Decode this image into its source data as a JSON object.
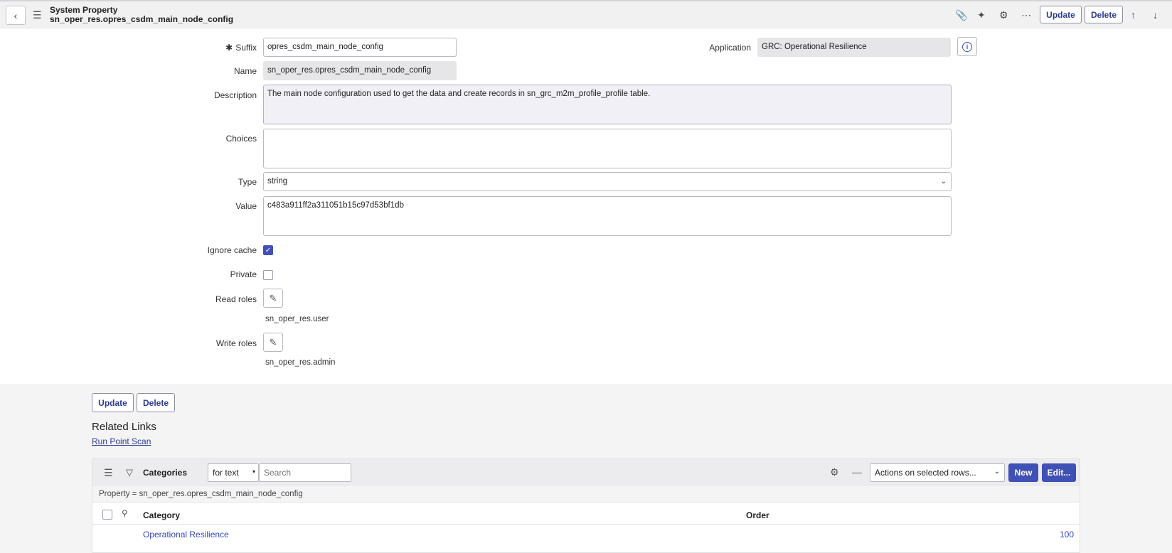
{
  "header": {
    "record_type": "System Property",
    "record_name": "sn_oper_res.opres_csdm_main_node_config",
    "update_label": "Update",
    "delete_label": "Delete"
  },
  "form": {
    "suffix": {
      "label": "Suffix",
      "value": "opres_csdm_main_node_config"
    },
    "name": {
      "label": "Name",
      "value": "sn_oper_res.opres_csdm_main_node_config"
    },
    "application": {
      "label": "Application",
      "value": "GRC: Operational Resilience"
    },
    "description": {
      "label": "Description",
      "value": "The main node configuration used to get the data and create records in sn_grc_m2m_profile_profile table."
    },
    "choices": {
      "label": "Choices",
      "value": ""
    },
    "type": {
      "label": "Type",
      "value": "string"
    },
    "value": {
      "label": "Value",
      "value": "c483a911ff2a311051b15c97d53bf1db"
    },
    "ignore_cache": {
      "label": "Ignore cache",
      "checked": true
    },
    "private": {
      "label": "Private",
      "checked": false
    },
    "read_roles": {
      "label": "Read roles",
      "value": "sn_oper_res.user"
    },
    "write_roles": {
      "label": "Write roles",
      "value": "sn_oper_res.admin"
    }
  },
  "bottom_buttons": {
    "update_label": "Update",
    "delete_label": "Delete"
  },
  "related_links": {
    "title": "Related Links",
    "run_point_scan": "Run Point Scan"
  },
  "related_list": {
    "title": "Categories",
    "search_field": "for text",
    "search_placeholder": "Search",
    "actions_label": "Actions on selected rows...",
    "new_label": "New",
    "edit_label": "Edit...",
    "condition": "Property = sn_oper_res.opres_csdm_main_node_config",
    "columns": [
      "Category",
      "Order"
    ],
    "rows": [
      {
        "category": "Operational Resilience",
        "order": "100"
      }
    ]
  },
  "colors": {
    "accent": "#3f51b5",
    "link": "#3346b8"
  }
}
